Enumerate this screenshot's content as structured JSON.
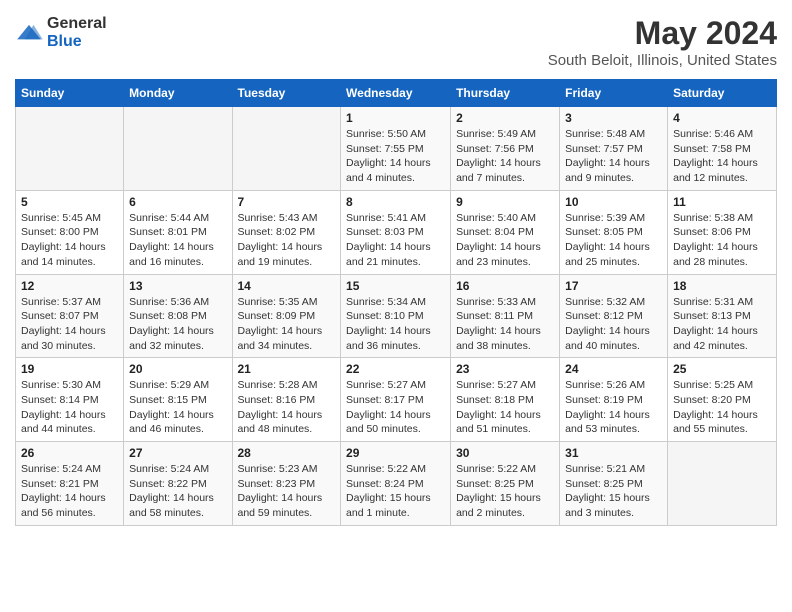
{
  "header": {
    "logo": {
      "text_general": "General",
      "text_blue": "Blue"
    },
    "title": "May 2024",
    "subtitle": "South Beloit, Illinois, United States"
  },
  "calendar": {
    "weekdays": [
      "Sunday",
      "Monday",
      "Tuesday",
      "Wednesday",
      "Thursday",
      "Friday",
      "Saturday"
    ],
    "weeks": [
      [
        {
          "day": "",
          "info": ""
        },
        {
          "day": "",
          "info": ""
        },
        {
          "day": "",
          "info": ""
        },
        {
          "day": "1",
          "info": "Sunrise: 5:50 AM\nSunset: 7:55 PM\nDaylight: 14 hours\nand 4 minutes."
        },
        {
          "day": "2",
          "info": "Sunrise: 5:49 AM\nSunset: 7:56 PM\nDaylight: 14 hours\nand 7 minutes."
        },
        {
          "day": "3",
          "info": "Sunrise: 5:48 AM\nSunset: 7:57 PM\nDaylight: 14 hours\nand 9 minutes."
        },
        {
          "day": "4",
          "info": "Sunrise: 5:46 AM\nSunset: 7:58 PM\nDaylight: 14 hours\nand 12 minutes."
        }
      ],
      [
        {
          "day": "5",
          "info": "Sunrise: 5:45 AM\nSunset: 8:00 PM\nDaylight: 14 hours\nand 14 minutes."
        },
        {
          "day": "6",
          "info": "Sunrise: 5:44 AM\nSunset: 8:01 PM\nDaylight: 14 hours\nand 16 minutes."
        },
        {
          "day": "7",
          "info": "Sunrise: 5:43 AM\nSunset: 8:02 PM\nDaylight: 14 hours\nand 19 minutes."
        },
        {
          "day": "8",
          "info": "Sunrise: 5:41 AM\nSunset: 8:03 PM\nDaylight: 14 hours\nand 21 minutes."
        },
        {
          "day": "9",
          "info": "Sunrise: 5:40 AM\nSunset: 8:04 PM\nDaylight: 14 hours\nand 23 minutes."
        },
        {
          "day": "10",
          "info": "Sunrise: 5:39 AM\nSunset: 8:05 PM\nDaylight: 14 hours\nand 25 minutes."
        },
        {
          "day": "11",
          "info": "Sunrise: 5:38 AM\nSunset: 8:06 PM\nDaylight: 14 hours\nand 28 minutes."
        }
      ],
      [
        {
          "day": "12",
          "info": "Sunrise: 5:37 AM\nSunset: 8:07 PM\nDaylight: 14 hours\nand 30 minutes."
        },
        {
          "day": "13",
          "info": "Sunrise: 5:36 AM\nSunset: 8:08 PM\nDaylight: 14 hours\nand 32 minutes."
        },
        {
          "day": "14",
          "info": "Sunrise: 5:35 AM\nSunset: 8:09 PM\nDaylight: 14 hours\nand 34 minutes."
        },
        {
          "day": "15",
          "info": "Sunrise: 5:34 AM\nSunset: 8:10 PM\nDaylight: 14 hours\nand 36 minutes."
        },
        {
          "day": "16",
          "info": "Sunrise: 5:33 AM\nSunset: 8:11 PM\nDaylight: 14 hours\nand 38 minutes."
        },
        {
          "day": "17",
          "info": "Sunrise: 5:32 AM\nSunset: 8:12 PM\nDaylight: 14 hours\nand 40 minutes."
        },
        {
          "day": "18",
          "info": "Sunrise: 5:31 AM\nSunset: 8:13 PM\nDaylight: 14 hours\nand 42 minutes."
        }
      ],
      [
        {
          "day": "19",
          "info": "Sunrise: 5:30 AM\nSunset: 8:14 PM\nDaylight: 14 hours\nand 44 minutes."
        },
        {
          "day": "20",
          "info": "Sunrise: 5:29 AM\nSunset: 8:15 PM\nDaylight: 14 hours\nand 46 minutes."
        },
        {
          "day": "21",
          "info": "Sunrise: 5:28 AM\nSunset: 8:16 PM\nDaylight: 14 hours\nand 48 minutes."
        },
        {
          "day": "22",
          "info": "Sunrise: 5:27 AM\nSunset: 8:17 PM\nDaylight: 14 hours\nand 50 minutes."
        },
        {
          "day": "23",
          "info": "Sunrise: 5:27 AM\nSunset: 8:18 PM\nDaylight: 14 hours\nand 51 minutes."
        },
        {
          "day": "24",
          "info": "Sunrise: 5:26 AM\nSunset: 8:19 PM\nDaylight: 14 hours\nand 53 minutes."
        },
        {
          "day": "25",
          "info": "Sunrise: 5:25 AM\nSunset: 8:20 PM\nDaylight: 14 hours\nand 55 minutes."
        }
      ],
      [
        {
          "day": "26",
          "info": "Sunrise: 5:24 AM\nSunset: 8:21 PM\nDaylight: 14 hours\nand 56 minutes."
        },
        {
          "day": "27",
          "info": "Sunrise: 5:24 AM\nSunset: 8:22 PM\nDaylight: 14 hours\nand 58 minutes."
        },
        {
          "day": "28",
          "info": "Sunrise: 5:23 AM\nSunset: 8:23 PM\nDaylight: 14 hours\nand 59 minutes."
        },
        {
          "day": "29",
          "info": "Sunrise: 5:22 AM\nSunset: 8:24 PM\nDaylight: 15 hours\nand 1 minute."
        },
        {
          "day": "30",
          "info": "Sunrise: 5:22 AM\nSunset: 8:25 PM\nDaylight: 15 hours\nand 2 minutes."
        },
        {
          "day": "31",
          "info": "Sunrise: 5:21 AM\nSunset: 8:25 PM\nDaylight: 15 hours\nand 3 minutes."
        },
        {
          "day": "",
          "info": ""
        }
      ]
    ]
  }
}
